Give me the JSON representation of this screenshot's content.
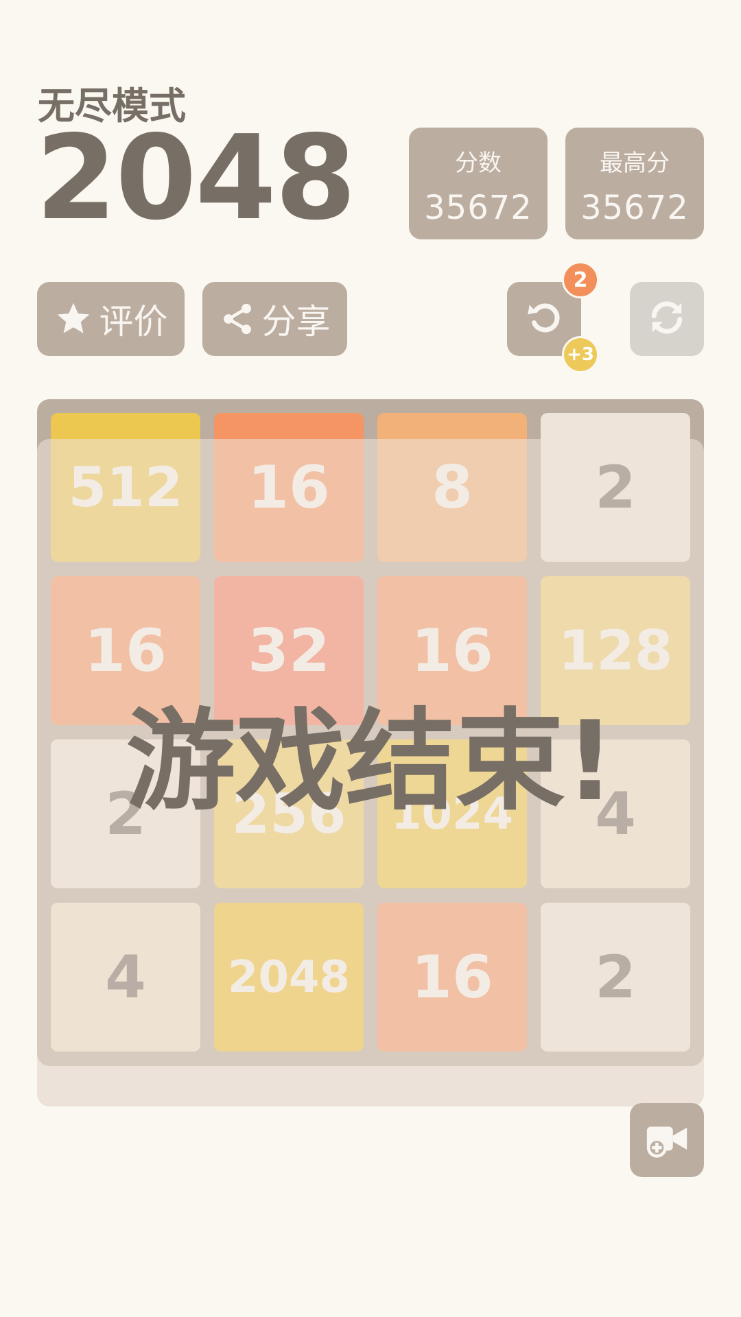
{
  "header": {
    "mode_label": "无尽模式",
    "title": "2048"
  },
  "scores": {
    "current_label": "分数",
    "current_value": "35672",
    "best_label": "最高分",
    "best_value": "35672"
  },
  "buttons": {
    "rate_label": "评价",
    "share_label": "分享",
    "undo_count": "2",
    "undo_bonus": "+3"
  },
  "board": {
    "tiles": [
      {
        "value": "512",
        "color": "#edc850"
      },
      {
        "value": "16",
        "color": "#f59563"
      },
      {
        "value": "8",
        "color": "#f2b179"
      },
      {
        "value": "2",
        "color": "#eee4da"
      },
      {
        "value": "16",
        "color": "#f59563"
      },
      {
        "value": "32",
        "color": "#f67c5f"
      },
      {
        "value": "16",
        "color": "#f59563"
      },
      {
        "value": "128",
        "color": "#edcf72"
      },
      {
        "value": "2",
        "color": "#eee4da"
      },
      {
        "value": "256",
        "color": "#edcc61"
      },
      {
        "value": "1024",
        "color": "#edc53f"
      },
      {
        "value": "4",
        "color": "#ede0c8"
      },
      {
        "value": "4",
        "color": "#ede0c8"
      },
      {
        "value": "2048",
        "color": "#edc22e"
      },
      {
        "value": "16",
        "color": "#f59563"
      },
      {
        "value": "2",
        "color": "#eee4da"
      }
    ]
  },
  "overlay": {
    "game_over_text": "游戏结束!"
  },
  "icons": {
    "rate": "star-icon",
    "share": "share-icon",
    "undo": "undo-icon",
    "restart": "refresh-icon",
    "record": "video-camera-plus-icon"
  },
  "colors": {
    "background": "#faf8f0",
    "panel": "#bbada0",
    "text_dark": "#776e65",
    "text_light": "#f9f6f2",
    "badge_orange": "#f28f5a",
    "badge_yellow": "#edc95a"
  }
}
